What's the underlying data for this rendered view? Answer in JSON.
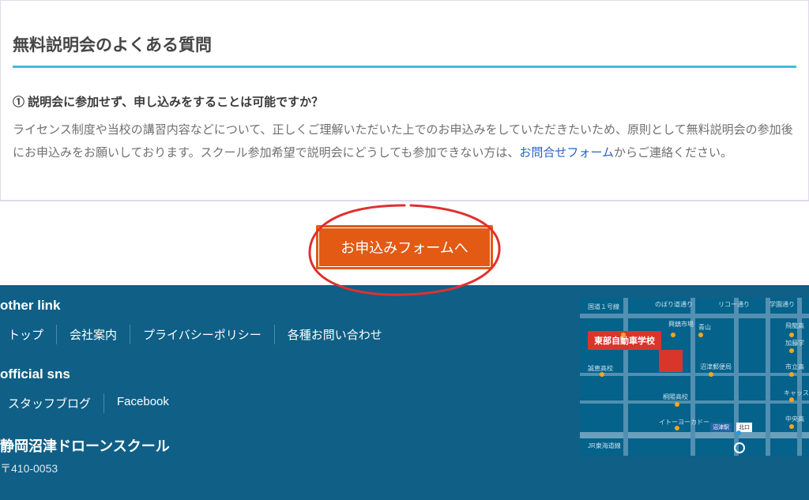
{
  "faq": {
    "heading": "無料説明会のよくある質問",
    "q1": "① 説明会に参加せず、申し込みをすることは可能ですか？",
    "a1_pre": "ライセンス制度や当校の講習内容などについて、正しくご理解いただいた上でのお申込みをしていただきたいため、原則として無料説明会の参加後にお申込みをお願いしております。スクール参加希望で説明会にどうしても参加できない方は、",
    "a1_link": "お問合せフォーム",
    "a1_post": "からご連絡ください。"
  },
  "cta": {
    "button": "お申込みフォームへ"
  },
  "footer": {
    "other_link_heading": "other link",
    "links": [
      "トップ",
      "会社案内",
      "プライバシーポリシー",
      "各種お問い合わせ"
    ],
    "sns_heading": "official sns",
    "sns_links": [
      "スタッフブログ",
      "Facebook"
    ],
    "school_name": "静岡沼津ドローンスクール",
    "postal": "〒410-0053"
  },
  "map": {
    "school_label": "東部自動車学校",
    "roads": {
      "kokudo1": "国道１号線",
      "nobori": "のぼり道通り",
      "rico": "リコー通り",
      "gakuen": "学園通り",
      "tokaido": "JR東海道線"
    },
    "places": {
      "seiko": "誠恵高校",
      "kirihata": "桐陽高校",
      "itoyokado": "イトーヨーカドー",
      "numazu_st": "沼津駅",
      "north_exit": "北口",
      "kounou": "興鎮市場",
      "aoyama": "青山",
      "numazu_post": "沼津郵便局",
      "hieda": "飛龍高",
      "kato": "加藤学",
      "shiritsu": "市立高",
      "caps": "キャッス",
      "chuo": "中央高"
    }
  }
}
